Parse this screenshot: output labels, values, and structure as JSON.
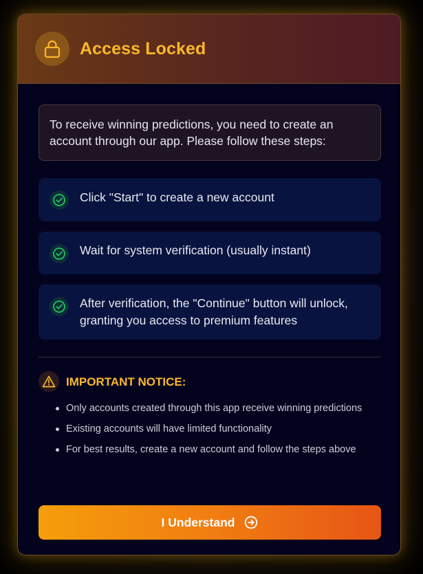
{
  "modal": {
    "title": "Access Locked",
    "intro": "To receive winning predictions, you need to create an account through our app. Please follow these steps:",
    "steps": [
      {
        "icon": "check-circle-icon",
        "text": "Click \"Start\" to create a new account"
      },
      {
        "icon": "check-circle-icon",
        "text": "Wait for system verification (usually instant)"
      },
      {
        "icon": "check-circle-icon",
        "text": "After verification, the \"Continue\" button will unlock, granting you access to premium features"
      }
    ],
    "notice": {
      "icon": "warning-icon",
      "title": "IMPORTANT NOTICE:",
      "items": [
        "Only accounts created through this app receive winning predictions",
        "Existing accounts will have limited functionality",
        "For best results, create a new account and follow the steps above"
      ]
    },
    "button": {
      "label": "I Understand",
      "icon": "arrow-right-circle-icon"
    }
  },
  "colors": {
    "accent": "#fbb92a",
    "check": "#22c55e",
    "button_start": "#f59e0b",
    "button_end": "#e65514",
    "panel_bg": "#04031e",
    "step_bg": "#08133f"
  }
}
